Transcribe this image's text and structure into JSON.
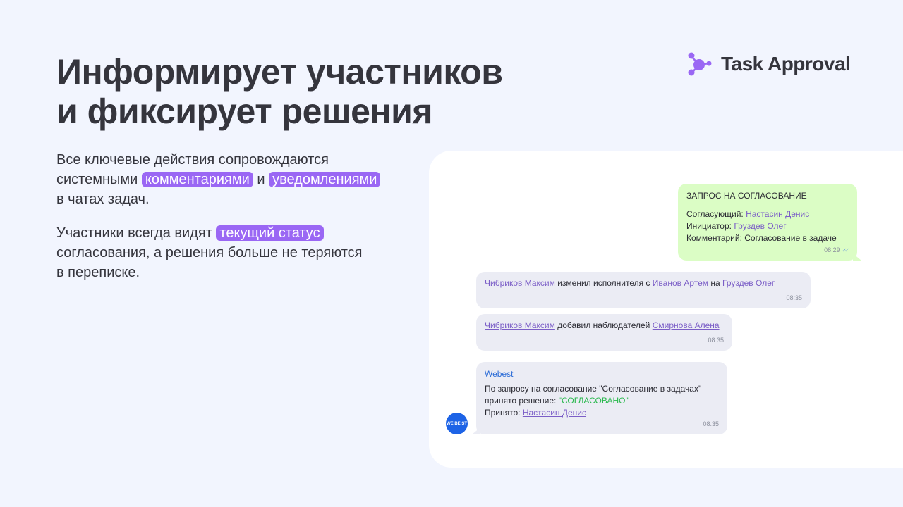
{
  "headline": {
    "line1": "Информирует участников",
    "line2": "и фиксирует решения"
  },
  "logo": {
    "icon": "molecule-icon",
    "text": "Task Approval",
    "color": "#9a67f4"
  },
  "para1": {
    "t1": "Все ключевые действия сопровождаются",
    "t2": "системными",
    "h1": "комментариями",
    "t3": "и",
    "h2": "уведомлениями",
    "t4": "в чатах задач."
  },
  "para2": {
    "t1": "Участники всегда видят",
    "h1": "текущий статус",
    "t2": "согласования, а решения больше не теряются",
    "t3": "в переписке."
  },
  "chat": {
    "approval_request": {
      "title": "ЗАПРОС НА СОГЛАСОВАНИЕ",
      "approver_label": "Согласующий:",
      "approver": "Настасин Денис",
      "initiator_label": "Инициатор:",
      "initiator": "Груздев Олег",
      "comment_label": "Комментарий:",
      "comment": "Согласование в задаче",
      "time": "08:29",
      "read_icon": "double-check-icon"
    },
    "sys1": {
      "user": "Чибриков Максим",
      "text1": "изменил исполнителя с",
      "from": "Иванов Артем",
      "text2": "на",
      "to": "Груздев Олег",
      "time": "08:35"
    },
    "sys2": {
      "user": "Чибриков Максим",
      "text1": "добавил наблюдателей",
      "observer": "Смирнова Алена",
      "time": "08:35"
    },
    "bot": {
      "sender": "Webest",
      "line1": "По запросу на согласование \"Согласование в задачах\"",
      "line2": "принято решение:",
      "status": "\"СОГЛАСОВАНО\"",
      "accepted_label": "Принято:",
      "accepted_by": "Настасин Денис",
      "time": "08:35",
      "avatar_text": "WE BE ST"
    }
  }
}
